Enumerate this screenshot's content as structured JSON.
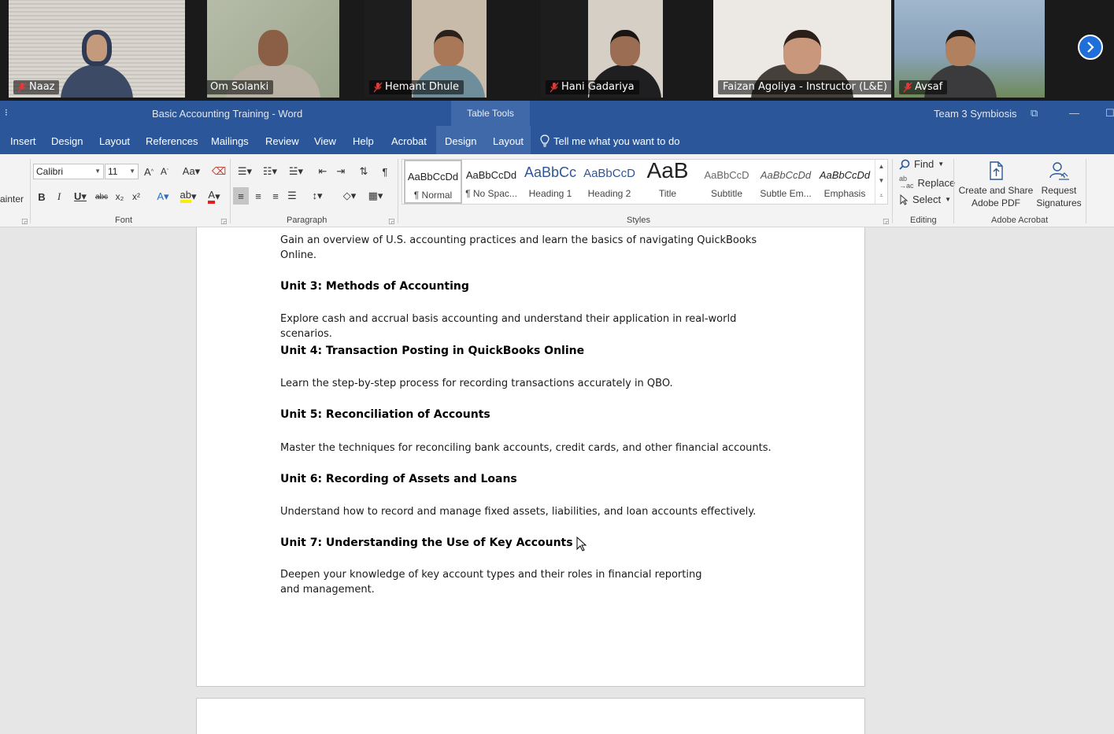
{
  "participants": [
    {
      "name": "Naaz",
      "bg": "#d8d5cf",
      "skin": "#c49a7c",
      "torso": "#3c4a66"
    },
    {
      "name": "Om Solanki",
      "bg": "#a9b19a",
      "skin": "#8a5f45",
      "torso": "#b9b1a3"
    },
    {
      "name": "Hemant Dhule",
      "bg": "#c8b9a8",
      "skin": "#a87858",
      "torso": "#6f8e9c"
    },
    {
      "name": "Hani Gadariya",
      "bg": "#d6cfc6",
      "skin": "#9b6d53",
      "torso": "#1f1f22"
    },
    {
      "name": "Faizan Agoliya - Instructor (L&E)",
      "bg": "#ece9e4",
      "skin": "#c9977c",
      "torso": "#45403a"
    },
    {
      "name": "Avsaf",
      "bg": "#8fa8bf",
      "skin": "#b0805f",
      "torso": "#3b3b3d"
    }
  ],
  "title_bar": {
    "doc_title": "Basic Accounting Training  -  Word",
    "table_tools": "Table Tools",
    "team": "Team 3 Symbiosis"
  },
  "ribbon_tabs": {
    "insert": "Insert",
    "design": "Design",
    "layout": "Layout",
    "references": "References",
    "mailings": "Mailings",
    "review": "Review",
    "view": "View",
    "help": "Help",
    "acrobat": "Acrobat",
    "table_design": "Design",
    "table_layout": "Layout",
    "tell_me": "Tell me what you want to do"
  },
  "ribbon": {
    "painter": "ainter",
    "font_name": "Calibri",
    "font_size": "11",
    "groups": {
      "font": "Font",
      "paragraph": "Paragraph",
      "styles": "Styles",
      "editing": "Editing",
      "adobe": "Adobe Acrobat"
    },
    "styles": [
      {
        "sample": "AaBbCcDd",
        "name": "¶ Normal"
      },
      {
        "sample": "AaBbCcDd",
        "name": "¶ No Spac..."
      },
      {
        "sample": "AaBbCc",
        "name": "Heading 1"
      },
      {
        "sample": "AaBbCcD",
        "name": "Heading 2"
      },
      {
        "sample": "AaB",
        "name": "Title"
      },
      {
        "sample": "AaBbCcD",
        "name": "Subtitle"
      },
      {
        "sample": "AaBbCcDd",
        "name": "Subtle Em..."
      },
      {
        "sample": "AaBbCcDd",
        "name": "Emphasis"
      }
    ],
    "editing": {
      "find": "Find",
      "replace": "Replace",
      "select": "Select"
    },
    "adobe": {
      "create_line1": "Create and Share",
      "create_line2": "Adobe PDF",
      "request_line1": "Request",
      "request_line2": "Signatures"
    }
  },
  "document": {
    "intro": "Gain an overview of U.S. accounting practices and learn the basics of navigating QuickBooks Online.",
    "units": [
      {
        "heading": "Unit 3: Methods of Accounting",
        "body": "Explore cash and accrual basis accounting and understand their application in real-world scenarios."
      },
      {
        "heading": "Unit 4: Transaction Posting in QuickBooks Online",
        "body": "Learn the step-by-step process for recording transactions accurately in QBO."
      },
      {
        "heading": "Unit 5: Reconciliation of Accounts",
        "body": "Master the techniques for reconciling bank accounts, credit cards, and other financial accounts."
      },
      {
        "heading": "Unit 6: Recording of Assets and Loans",
        "body": "Understand how to record and manage fixed assets, liabilities, and loan accounts effectively."
      },
      {
        "heading": "Unit 7: Understanding the Use of Key Accounts",
        "body": "Deepen your knowledge of key account types and their roles in financial reporting and management."
      }
    ]
  }
}
